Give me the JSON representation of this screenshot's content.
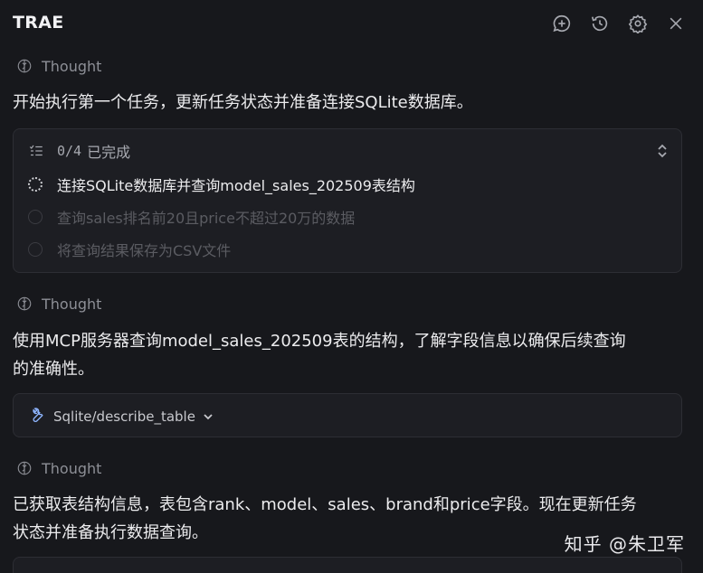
{
  "header": {
    "title": "TRAE",
    "icons": [
      "chat-add-icon",
      "history-icon",
      "gear-icon",
      "close-icon"
    ]
  },
  "blocks": {
    "thought_label": "Thought",
    "para1": "开始执行第一个任务，更新任务状态并准备连接SQLite数据库。",
    "todo": {
      "count": "0/4",
      "status": "已完成",
      "tasks": [
        {
          "label": "连接SQLite数据库并查询model_sales_202509表结构",
          "state": "in-progress"
        },
        {
          "label": "查询sales排名前20且price不超过20万的数据",
          "state": "pending"
        },
        {
          "label": "将查询结果保存为CSV文件",
          "state": "pending"
        }
      ]
    },
    "para2_line1": "使用MCP服务器查询model_sales_202509表的结构，了解字段信息以确保后续查询",
    "para2_line2": "的准确性。",
    "tool": {
      "name": "Sqlite/describe_table"
    },
    "para3_line1": "已获取表结构信息，表包含rank、model、sales、brand和price字段。现在更新任务",
    "para3_line2": "状态并准备执行数据查询。"
  },
  "watermark": "知乎 @朱卫军",
  "colors": {
    "background": "#17181c",
    "card": "#1d1e23",
    "border": "#2d2e34",
    "tool_icon": "#8fb6ff"
  }
}
